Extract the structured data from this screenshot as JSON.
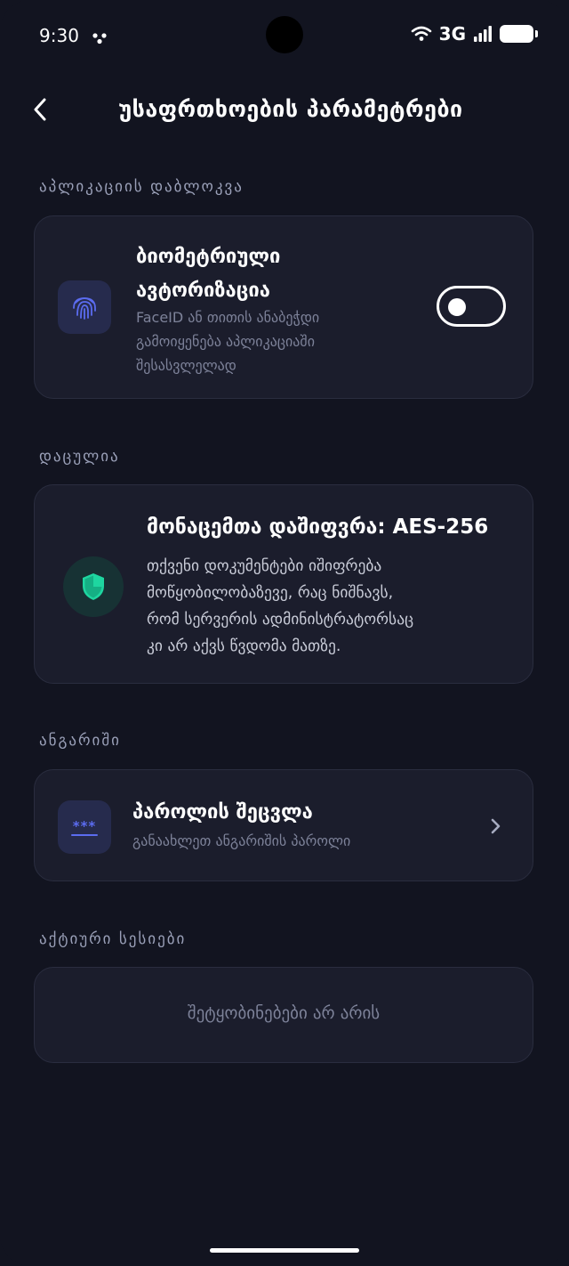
{
  "status_bar": {
    "time": "9:30",
    "network": "3G",
    "icons": [
      "dots-icon",
      "wifi-icon",
      "signal-icon",
      "battery-icon"
    ]
  },
  "header": {
    "title": "უსაფრთხოების პარამეტრები",
    "back_icon": "chevron-left-icon"
  },
  "sections": {
    "app_lock": {
      "label": "აპლიკაციის დაბლოკვა",
      "biometric": {
        "title_line1": "ბიომეტრიული",
        "title_line2": "ავტორიზაცია",
        "desc_line1": "FaceID ან თითის ანაბეჭდი",
        "desc_line2": "გამოიყენება აპლიკაციაში",
        "desc_line3": "შესასვლელად",
        "icon": "fingerprint-icon",
        "toggle_on": false
      }
    },
    "protected": {
      "label": "დაცულია",
      "encryption": {
        "title": "მონაცემთა დაშიფვრა: AES-256",
        "desc_line1": "თქვენი დოკუმენტები იშიფრება",
        "desc_line2": "მოწყობილობაზევე, რაც ნიშნავს,",
        "desc_line3": "რომ სერვერის ადმინისტრატორსაც",
        "desc_line4": "კი არ აქვს წვდომა მათზე.",
        "icon": "shield-check-icon"
      }
    },
    "account": {
      "label": "ანგარიში",
      "password": {
        "title": "პაროლის შეცვლა",
        "desc": "განაახლეთ ანგარიშის პაროლი",
        "icon_text": "***",
        "icon": "password-icon"
      }
    },
    "sessions": {
      "label": "აქტიური სესიები",
      "empty": "შეტყობინებები არ არის"
    }
  },
  "colors": {
    "background": "#121420",
    "card": "#1b1d2c",
    "accent_blue": "#5b6cf0",
    "accent_green": "#1ed6a0",
    "muted_text": "#7d8299"
  }
}
